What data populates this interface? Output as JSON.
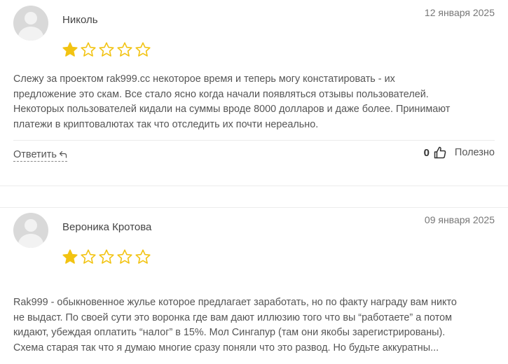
{
  "reviews": [
    {
      "author": "Николь",
      "date": "12 января 2025",
      "rating": 1,
      "max_rating": 5,
      "text_lines": [
        "Слежу за проектом rak999.cc некоторое время и теперь могу констатировать - их",
        "предложение это скам. Все стало ясно когда начали появляться отзывы пользователей.",
        "Некоторых пользователей кидали на суммы вроде 8000 долларов и даже более. Принимают",
        "платежи в криптовалютах так что отследить их почти нереально."
      ],
      "reply_label": "Ответить",
      "likes": "0",
      "helpful_label": "Полезно"
    },
    {
      "author": "Вероника Кротова",
      "date": "09 января 2025",
      "rating": 1,
      "max_rating": 5,
      "text_lines": [
        "Rak999 - обыкновенное жулье которое предлагает заработать, но по факту награду вам никто",
        "не выдаст. По своей сути это воронка где вам дают иллюзию того что вы “работаете” а потом",
        "кидают, убеждая оплатить “налог” в 15%. Мол Сингапур (там они якобы зарегистрированы).",
        "Схема старая так что я думаю многие сразу поняли что это развод. Но будьте аккуратны..."
      ]
    }
  ],
  "colors": {
    "star_filled": "#f2c312",
    "star_empty_stroke": "#f2c312",
    "avatar_bg": "#d9d9d9"
  },
  "icons": {
    "reply": "reply-arrow-icon",
    "like": "thumbs-up-icon",
    "star": "star-icon"
  }
}
